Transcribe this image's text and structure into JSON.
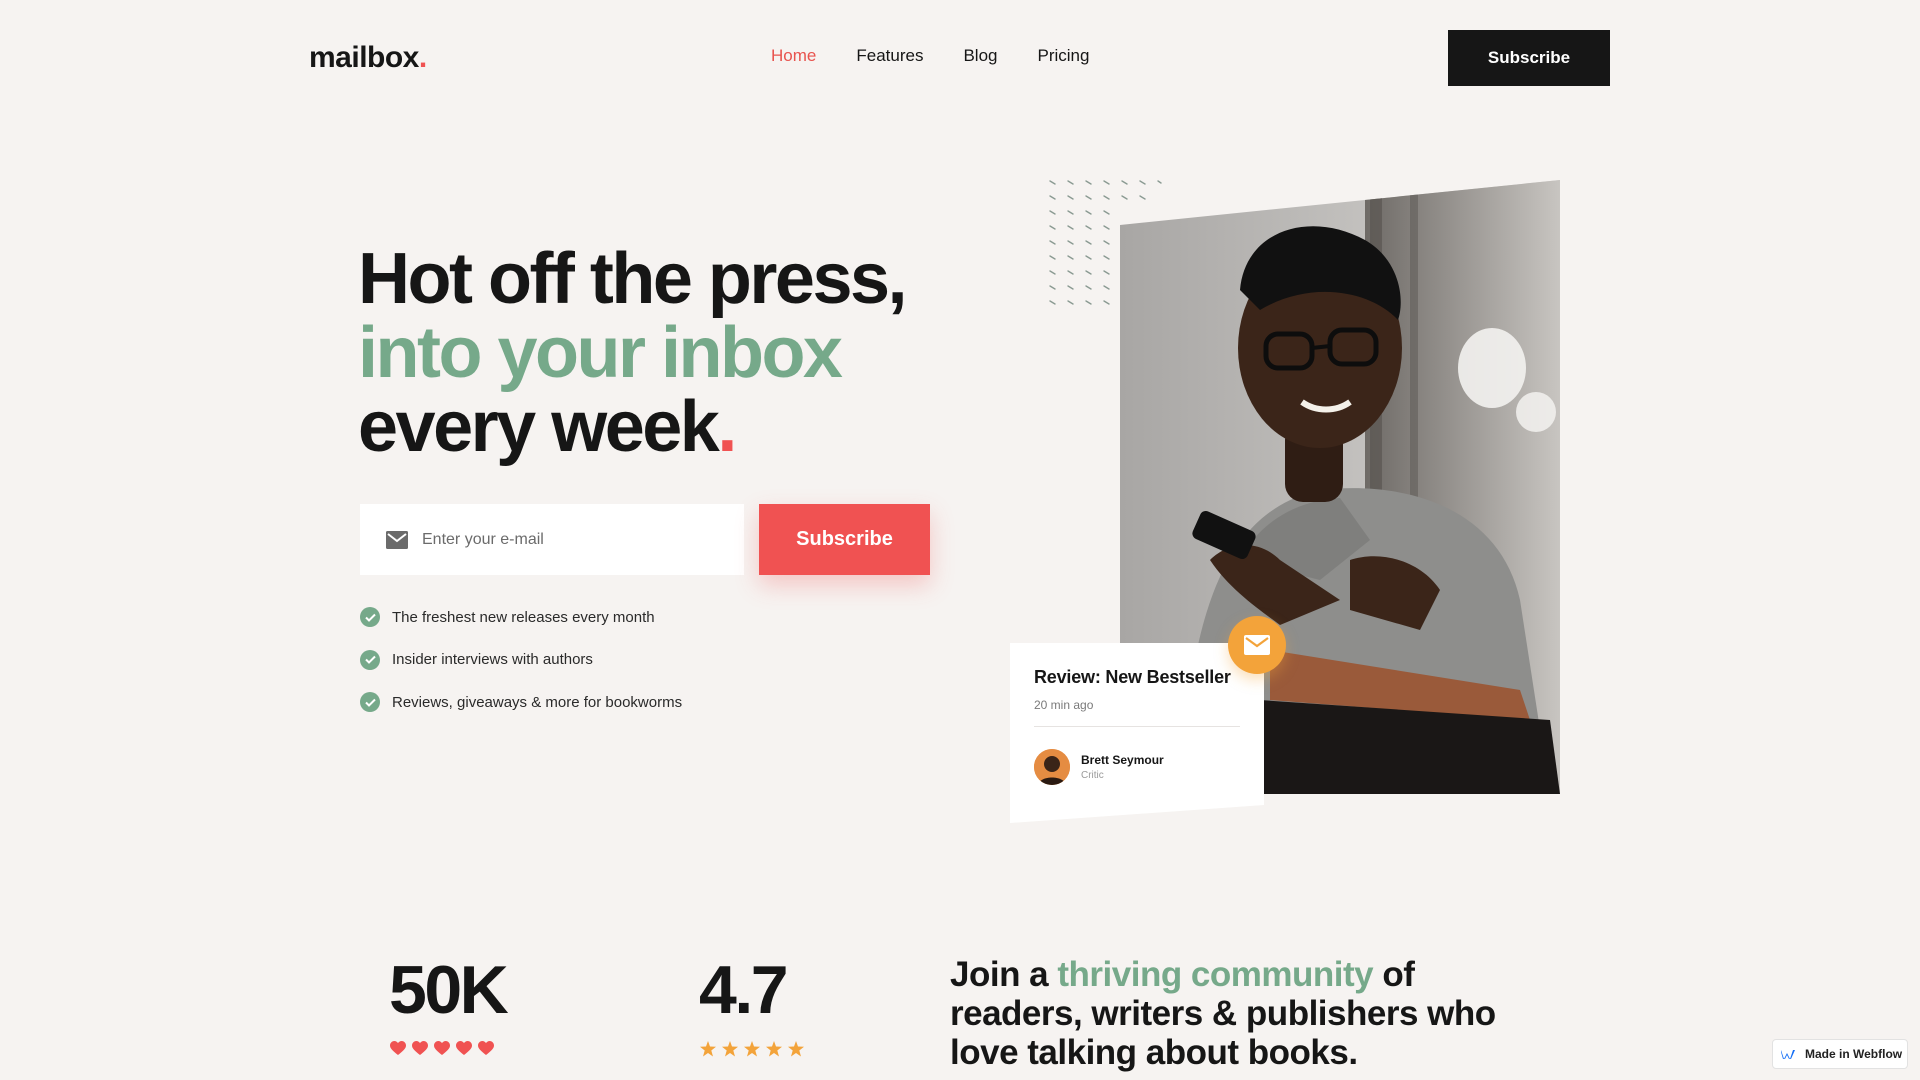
{
  "nav": {
    "logo_text": "mailbox",
    "logo_dot": ".",
    "links": [
      "Home",
      "Features",
      "Blog",
      "Pricing"
    ],
    "active_link": "Home",
    "cta_label": "Subscribe"
  },
  "hero": {
    "title_line1": "Hot off the press,",
    "title_line2": "into your inbox",
    "title_line3": "every week",
    "title_dot": ".",
    "email_placeholder": "Enter your e-mail",
    "email_icon": "envelope-icon",
    "subscribe_label": "Subscribe",
    "features": [
      "The freshest new releases every month",
      "Insider interviews with authors",
      "Reviews, giveaways & more for bookworms"
    ]
  },
  "review_card": {
    "title": "Review: New Bestseller",
    "time": "20 min ago",
    "author_name": "Brett Seymour",
    "author_role": "Critic",
    "badge_icon": "mail-icon"
  },
  "stats": {
    "subscribers": "50K",
    "subscribers_icons": "heart-icon",
    "rating": "4.7",
    "rating_icons": "star-icon"
  },
  "community": {
    "prefix": "Join a ",
    "highlight": "thriving community",
    "suffix": " of readers, writers & publishers who love talking about books."
  },
  "webflow_badge": "Made in Webflow",
  "colors": {
    "background": "#f6f3f1",
    "accent_red": "#f05252",
    "accent_green": "#76a98a",
    "dark": "#161616",
    "badge_orange": "#f3a33a"
  }
}
